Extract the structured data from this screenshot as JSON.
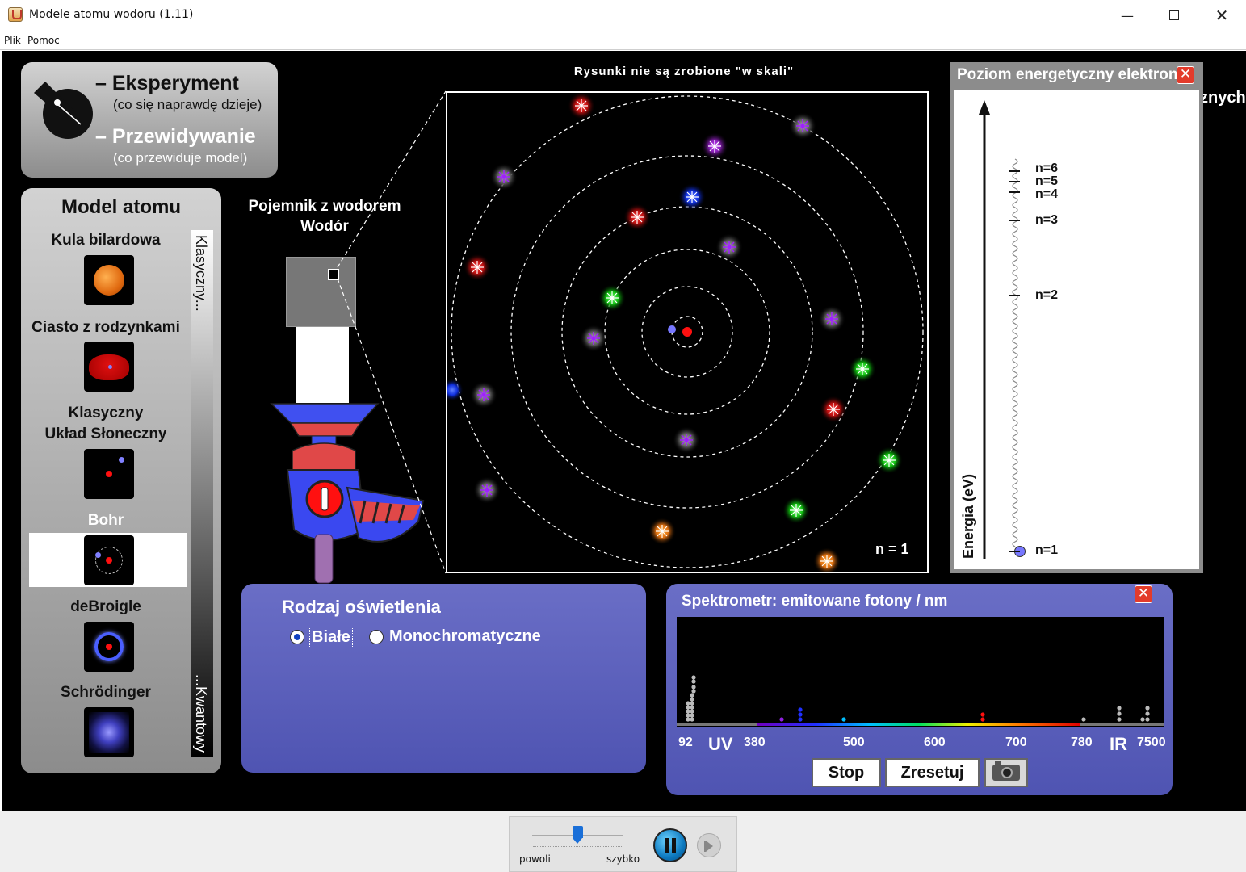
{
  "window": {
    "title": "Modele atomu wodoru (1.11)",
    "minimize_icon": "minimize-icon",
    "maximize_icon": "maximize-icon",
    "close_icon": "close-icon"
  },
  "menu": {
    "file": "Plik",
    "help": "Pomoc"
  },
  "mode_panel": {
    "experiment_label": "– Eksperyment",
    "experiment_sub": "(co się naprawdę dzieje)",
    "prediction_label": "– Przewidywanie",
    "prediction_sub": "(co przewiduje model)",
    "selected": "Przewidywanie"
  },
  "model_panel": {
    "title": "Model atomu",
    "scale_top": "Klasyczny...",
    "scale_bottom": "...Kwantowy",
    "models": [
      {
        "label": "Kula bilardowa"
      },
      {
        "label": "Ciasto z rodzynkami"
      },
      {
        "label": "Klasyczny\nUkład Słoneczny"
      },
      {
        "label": "Bohr"
      },
      {
        "label": "deBroigle"
      },
      {
        "label": "Schrödinger"
      }
    ],
    "selected_model": "Bohr"
  },
  "container": {
    "title": "Pojemnik z wodorem",
    "gas": "Wodór"
  },
  "zoom": {
    "caption": "Rysunki nie są zrobione \"w skali\"",
    "state_label": "n = 1"
  },
  "energy_panel": {
    "title": "Poziom energetyczny elektronu",
    "clipped_text": "znych",
    "axis_label": "Energia (eV)",
    "levels": [
      "n=6",
      "n=5",
      "n=4",
      "n=3",
      "n=2",
      "n=1"
    ],
    "current_level": 1
  },
  "light_panel": {
    "title": "Rodzaj oświetlenia",
    "option_white": "Białe",
    "option_mono": "Monochromatyczne",
    "selected": "Białe"
  },
  "spectrometer": {
    "title": "Spektrometr: emitowane fotony / nm",
    "ticks": [
      "92",
      "UV",
      "380",
      "500",
      "600",
      "700",
      "780",
      "IR",
      "7500"
    ],
    "stop_label": "Stop",
    "reset_label": "Zresetuj",
    "camera_icon": "camera-icon"
  },
  "clock": {
    "slow_label": "powoli",
    "fast_label": "szybko",
    "speed": 0.5,
    "state": "running"
  },
  "colors": {
    "stage": "#000000",
    "gray_panel": "#a8a8a8",
    "blue_panel": "#5a5fb8",
    "close_red": "#e33b2b",
    "electron": "#7777ff",
    "proton": "#ff0000"
  }
}
